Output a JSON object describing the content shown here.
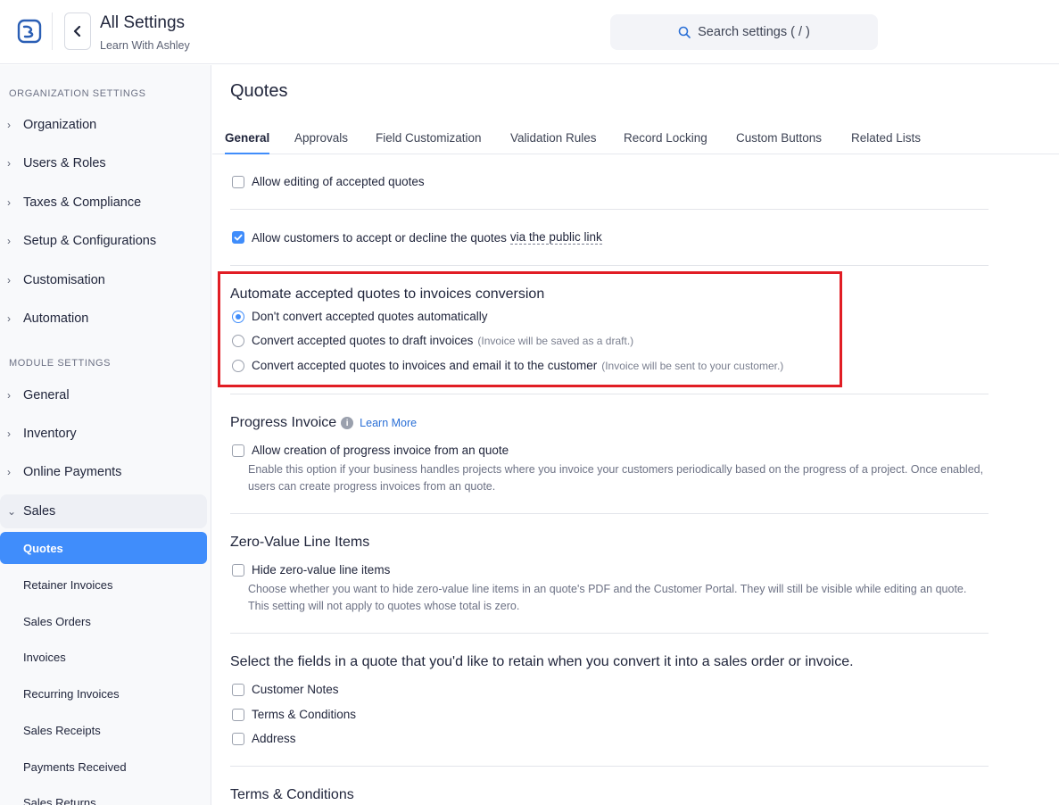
{
  "header": {
    "title": "All Settings",
    "subtitle": "Learn With Ashley",
    "search_placeholder": "Search settings ( / )"
  },
  "sidebar": {
    "org_section": "ORGANIZATION SETTINGS",
    "org_items": [
      "Organization",
      "Users & Roles",
      "Taxes & Compliance",
      "Setup & Configurations",
      "Customisation",
      "Automation"
    ],
    "module_section": "MODULE SETTINGS",
    "module_items": [
      "General",
      "Inventory",
      "Online Payments",
      "Sales"
    ],
    "sales_items": [
      "Quotes",
      "Retainer Invoices",
      "Sales Orders",
      "Invoices",
      "Recurring Invoices",
      "Sales Receipts",
      "Payments Received",
      "Sales Returns"
    ],
    "active_item": "Quotes"
  },
  "main": {
    "title": "Quotes",
    "tabs": [
      "General",
      "Approvals",
      "Field Customization",
      "Validation Rules",
      "Record Locking",
      "Custom Buttons",
      "Related Lists"
    ],
    "active_tab": "General",
    "allow_editing": {
      "label": "Allow editing of accepted quotes",
      "checked": false
    },
    "allow_customers": {
      "label": "Allow customers to accept or decline the quotes",
      "link": "via the public link",
      "checked": true
    },
    "automate": {
      "title": "Automate accepted quotes to invoices conversion",
      "options": [
        {
          "label": "Don't convert accepted quotes automatically",
          "hint": "",
          "checked": true
        },
        {
          "label": "Convert accepted quotes to draft invoices",
          "hint": "(Invoice will be saved as a draft.)",
          "checked": false
        },
        {
          "label": "Convert accepted quotes to invoices and email it to the customer",
          "hint": "(Invoice will be sent to your customer.)",
          "checked": false
        }
      ]
    },
    "progress": {
      "title": "Progress Invoice",
      "learn_more": "Learn More",
      "label": "Allow creation of progress invoice from an quote",
      "desc": "Enable this option if your business handles projects where you invoice your customers periodically based on the progress of a project. Once enabled, users can create progress invoices from an quote."
    },
    "zero_value": {
      "title": "Zero-Value Line Items",
      "label": "Hide zero-value line items",
      "desc": "Choose whether you want to hide zero-value line items in an quote's PDF and the Customer Portal. They will still be visible while editing an quote. This setting will not apply to quotes whose total is zero."
    },
    "retain": {
      "title": "Select the fields in a quote that you'd like to retain when you convert it into a sales order or invoice.",
      "fields": [
        "Customer Notes",
        "Terms & Conditions",
        "Address"
      ]
    },
    "terms_title": "Terms & Conditions"
  },
  "colors": {
    "accent": "#408dfb",
    "highlight_border": "#e11d24"
  }
}
